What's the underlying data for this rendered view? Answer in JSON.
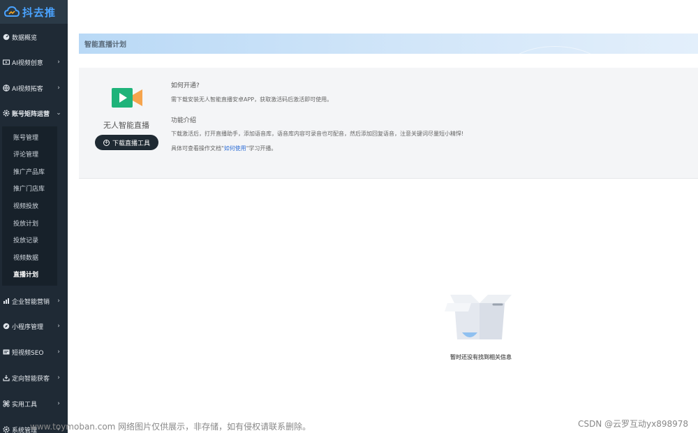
{
  "app": {
    "logo_text": "抖去推"
  },
  "sidebar": {
    "items": [
      {
        "label": "数据概览",
        "icon": "dashboard-icon",
        "has_arrow": false
      },
      {
        "label": "AI视频创意",
        "icon": "video-icon",
        "has_arrow": true
      },
      {
        "label": "AI视频拓客",
        "icon": "globe-icon",
        "has_arrow": true
      },
      {
        "label": "账号矩阵运营",
        "icon": "gear-icon",
        "has_arrow": true,
        "expanded": true
      },
      {
        "label": "企业智能营销",
        "icon": "bar-chart-icon",
        "has_arrow": true
      },
      {
        "label": "小程序管理",
        "icon": "compass-icon",
        "has_arrow": true
      },
      {
        "label": "短视频SEO",
        "icon": "seo-icon",
        "has_arrow": true
      },
      {
        "label": "定向智能获客",
        "icon": "target-icon",
        "has_arrow": true
      },
      {
        "label": "实用工具",
        "icon": "tools-icon",
        "has_arrow": true
      },
      {
        "label": "系统管理",
        "icon": "settings-icon",
        "has_arrow": true
      }
    ],
    "submenu": [
      "账号管理",
      "评论管理",
      "推广产品库",
      "推广门店库",
      "视频投放",
      "投放计划",
      "投放记录",
      "视频数据",
      "直播计划"
    ],
    "current_sub": "直播计划"
  },
  "page": {
    "title": "智能直播计划",
    "product_name": "无人智能直播",
    "download_button": "下载直播工具",
    "how_title": "如何开通?",
    "how_text": "需下载安装无人智能直播安卓APP，获取激活码后激活即可使用。",
    "feature_title": "功能介绍",
    "feature_text": "下载激活后，打开直播助手，添加语音库，语音库内容可录音也可配音，然后添加回复语音，注意关键词尽量短小精悍!",
    "doc_prefix": "具体可查看操作文档\"",
    "doc_link": "如何使用",
    "doc_suffix": "\"学习开播。",
    "empty_text": "暂时还没有找到相关信息"
  },
  "watermark": {
    "left": "www.toymoban.com 网络图片仅供展示，非存储，如有侵权请联系删除。",
    "right": "CSDN @云罗互动yx898978"
  },
  "colors": {
    "sidebar_bg": "#1f2a35",
    "accent": "#4aa3ff",
    "link": "#2f6fd6"
  }
}
